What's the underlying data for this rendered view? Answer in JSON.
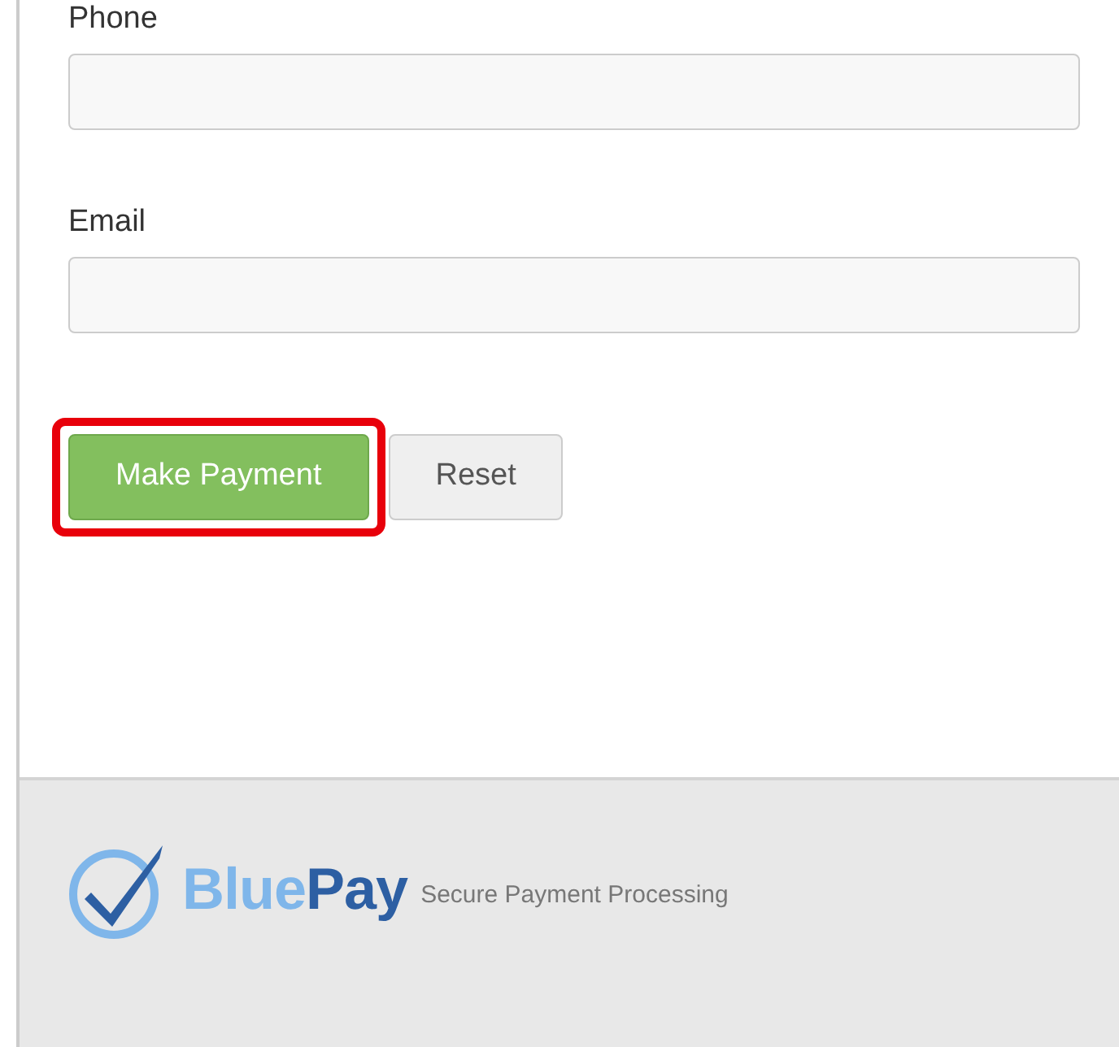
{
  "form": {
    "fields": [
      {
        "label": "Phone"
      },
      {
        "label": "Email"
      }
    ],
    "buttons": [
      {
        "label": "Make Payment",
        "kind": "primary",
        "highlighted": true
      },
      {
        "label": "Reset",
        "kind": "secondary",
        "highlighted": false
      }
    ]
  },
  "footer": {
    "brand_parts": [
      "Blue",
      "Pay"
    ],
    "tagline": "Secure Payment Processing"
  }
}
